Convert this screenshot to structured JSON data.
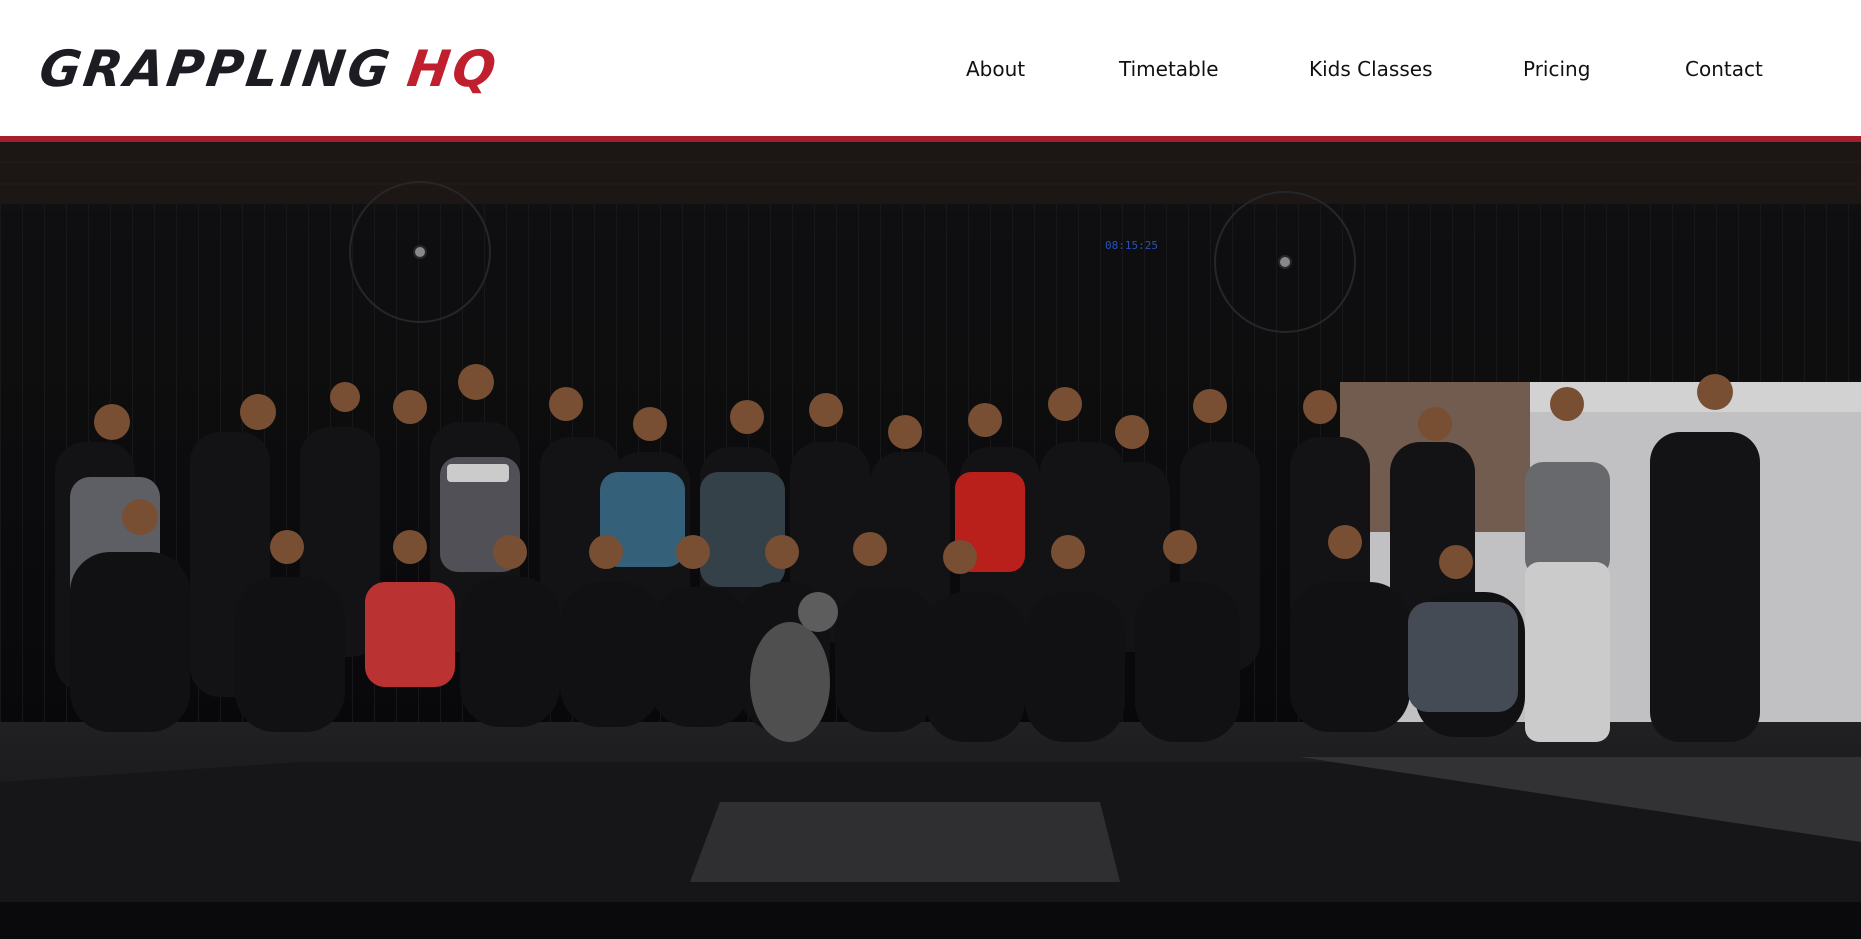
{
  "brand": {
    "logo_word1": "GRAPPLING",
    "logo_word2": "HQ",
    "accent_color": "#c01f2e",
    "bar_color": "#a51e2c"
  },
  "nav": {
    "items": [
      {
        "label": "About"
      },
      {
        "label": "Timetable"
      },
      {
        "label": "Kids Classes"
      },
      {
        "label": "Pricing"
      },
      {
        "label": "Contact"
      }
    ]
  },
  "hero": {
    "clock_text": "08:15:25"
  }
}
